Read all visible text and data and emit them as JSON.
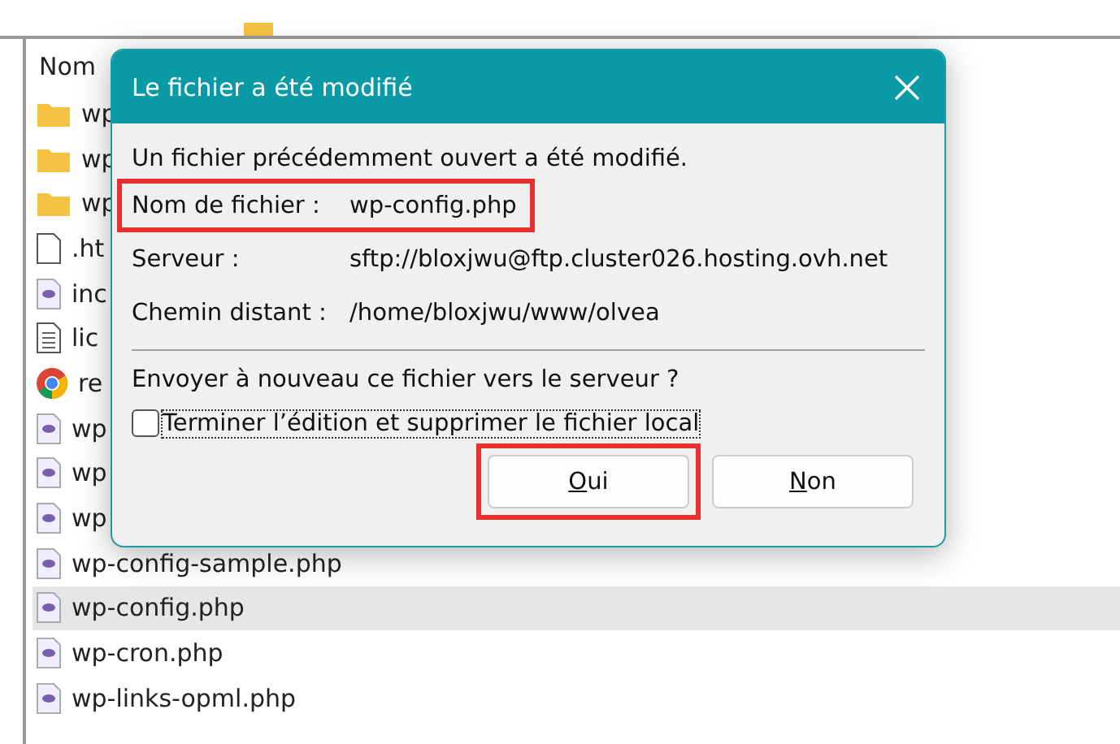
{
  "file_list": {
    "column_header": "Nom",
    "rows": [
      {
        "kind": "folder",
        "name": "wp",
        "selected": false
      },
      {
        "kind": "folder",
        "name": "wp",
        "selected": false
      },
      {
        "kind": "folder",
        "name": "wp",
        "selected": false
      },
      {
        "kind": "blank",
        "name": ".ht",
        "selected": false
      },
      {
        "kind": "php",
        "name": "inc",
        "selected": false
      },
      {
        "kind": "text",
        "name": "lic",
        "selected": false
      },
      {
        "kind": "browser",
        "name": "re",
        "selected": false
      },
      {
        "kind": "php",
        "name": "wp",
        "selected": false
      },
      {
        "kind": "php",
        "name": "wp",
        "selected": false
      },
      {
        "kind": "php",
        "name": "wp",
        "selected": false
      },
      {
        "kind": "php",
        "name": "wp-config-sample.php",
        "selected": false
      },
      {
        "kind": "php",
        "name": "wp-config.php",
        "selected": true
      },
      {
        "kind": "php",
        "name": "wp-cron.php",
        "selected": false
      },
      {
        "kind": "php",
        "name": "wp-links-opml.php",
        "selected": false
      }
    ]
  },
  "dialog": {
    "title": "Le fichier a été modifié",
    "message": "Un fichier précédemment ouvert a été modifié.",
    "details": [
      {
        "label": "Nom de fichier :",
        "value": "wp-config.php",
        "highlighted": true
      },
      {
        "label": "Serveur :",
        "value": "sftp://bloxjwu@ftp.cluster026.hosting.ovh.net",
        "highlighted": false
      },
      {
        "label": "Chemin distant :",
        "value": "/home/bloxjwu/www/olvea",
        "highlighted": false
      }
    ],
    "question": "Envoyer à nouveau ce fichier vers le serveur ?",
    "checkbox": {
      "label": "Terminer l’édition et supprimer le fichier local",
      "checked": false
    },
    "buttons": [
      {
        "label": "Oui",
        "highlighted": true
      },
      {
        "label": "Non",
        "highlighted": false
      }
    ]
  }
}
